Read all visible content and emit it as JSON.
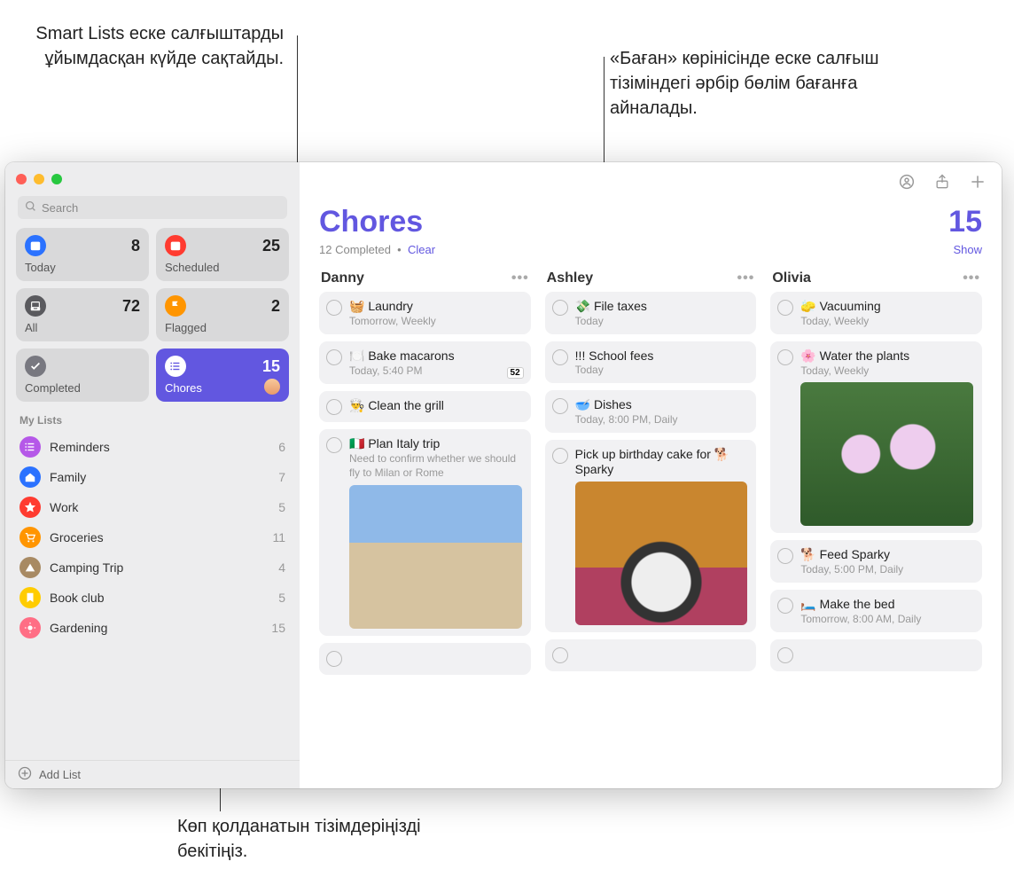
{
  "callouts": {
    "smart_lists": "Smart Lists еске салғыштарды ұйымдасқан күйде сақтайды.",
    "columns_view": "«Баған» көрінісінде еске салғыш тізіміндегі әрбір бөлім бағанға айналады.",
    "pin_lists": "Көп қолданатын тізімдеріңізді бекітіңіз."
  },
  "search": {
    "placeholder": "Search"
  },
  "smart_tiles": [
    {
      "label": "Today",
      "count": "8",
      "icon": "calendar-today",
      "color": "#2b72ff"
    },
    {
      "label": "Scheduled",
      "count": "25",
      "icon": "calendar",
      "color": "#ff3b30"
    },
    {
      "label": "All",
      "count": "72",
      "icon": "tray",
      "color": "#5a5a5e"
    },
    {
      "label": "Flagged",
      "count": "2",
      "icon": "flag",
      "color": "#ff9500"
    },
    {
      "label": "Completed",
      "count": "",
      "icon": "check",
      "color": "#787880"
    },
    {
      "label": "Chores",
      "count": "15",
      "icon": "list",
      "color": "#fff",
      "active": true,
      "avatar": true
    }
  ],
  "lists_header": "My Lists",
  "lists": [
    {
      "label": "Reminders",
      "count": "6",
      "color": "#b558e8",
      "icon": "list"
    },
    {
      "label": "Family",
      "count": "7",
      "color": "#2b72ff",
      "icon": "home"
    },
    {
      "label": "Work",
      "count": "5",
      "color": "#ff3b30",
      "icon": "star"
    },
    {
      "label": "Groceries",
      "count": "11",
      "color": "#ff9500",
      "icon": "cart"
    },
    {
      "label": "Camping Trip",
      "count": "4",
      "color": "#a88a63",
      "icon": "tent"
    },
    {
      "label": "Book club",
      "count": "5",
      "color": "#ffcc00",
      "icon": "bookmark"
    },
    {
      "label": "Gardening",
      "count": "15",
      "color": "#ff6e85",
      "icon": "sun"
    }
  ],
  "add_list_label": "Add List",
  "header": {
    "title": "Chores",
    "count": "15",
    "completed": "12 Completed",
    "clear": "Clear",
    "show": "Show"
  },
  "columns": [
    {
      "name": "Danny",
      "cards": [
        {
          "title": "🧺 Laundry",
          "meta": "Tomorrow, Weekly"
        },
        {
          "title": "🍽️ Bake macarons",
          "meta": "Today, 5:40 PM",
          "badge": "52"
        },
        {
          "title": "👨‍🍳 Clean the grill"
        },
        {
          "title": "🇮🇹 Plan Italy trip",
          "note": "Need to confirm whether we should fly to Milan or Rome",
          "image": "harbor"
        },
        {
          "empty": true
        }
      ]
    },
    {
      "name": "Ashley",
      "cards": [
        {
          "title": "💸 File taxes",
          "meta": "Today"
        },
        {
          "title": "!!! School fees",
          "meta": "Today"
        },
        {
          "title": "🥣 Dishes",
          "meta": "Today, 8:00 PM, Daily"
        },
        {
          "title": "Pick up birthday cake for 🐕 Sparky",
          "image": "dog"
        },
        {
          "empty": true
        }
      ]
    },
    {
      "name": "Olivia",
      "cards": [
        {
          "title": "🧽 Vacuuming",
          "meta": "Today, Weekly"
        },
        {
          "title": "🌸 Water the plants",
          "meta": "Today, Weekly",
          "image": "flower"
        },
        {
          "title": "🐕 Feed Sparky",
          "meta": "Today, 5:00 PM, Daily"
        },
        {
          "title": "🛏️ Make the bed",
          "meta": "Tomorrow, 8:00 AM, Daily"
        },
        {
          "empty": true
        }
      ]
    }
  ]
}
